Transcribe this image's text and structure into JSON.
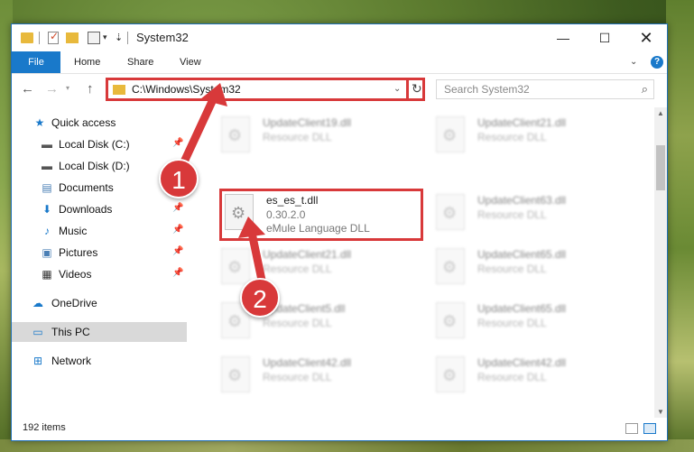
{
  "window": {
    "title": "System32",
    "controls": {
      "minimize": "—",
      "maximize": "☐",
      "close": "✕"
    }
  },
  "ribbon": {
    "tabs": [
      "File",
      "Home",
      "Share",
      "View"
    ],
    "help": "?"
  },
  "address": {
    "path": "C:\\Windows\\System32",
    "search_placeholder": "Search System32"
  },
  "nav_pane": {
    "items": [
      {
        "label": "Quick access",
        "icon": "star-icon",
        "pinned": false
      },
      {
        "label": "Local Disk (C:)",
        "icon": "drive-icon",
        "pinned": true
      },
      {
        "label": "Local Disk (D:)",
        "icon": "drive-icon",
        "pinned": false
      },
      {
        "label": "Documents",
        "icon": "documents-icon",
        "pinned": true
      },
      {
        "label": "Downloads",
        "icon": "download-icon",
        "pinned": true
      },
      {
        "label": "Music",
        "icon": "music-icon",
        "pinned": true
      },
      {
        "label": "Pictures",
        "icon": "pictures-icon",
        "pinned": true
      },
      {
        "label": "Videos",
        "icon": "videos-icon",
        "pinned": true
      },
      {
        "label": "OneDrive",
        "icon": "cloud-icon",
        "pinned": false
      },
      {
        "label": "This PC",
        "icon": "computer-icon",
        "pinned": false,
        "selected": true
      },
      {
        "label": "Network",
        "icon": "network-icon",
        "pinned": false
      }
    ]
  },
  "files": {
    "selected": {
      "name": "es_es_t.dll",
      "version": "0.30.2.0",
      "description": "eMule Language DLL"
    },
    "background": [
      {
        "name": "UpdateClient19.dll",
        "type": "Resource DLL"
      },
      {
        "name": "UpdateClient21.dll",
        "type": "Resource DLL"
      },
      {
        "name": "UpdateClient63.dll",
        "type": "Resource DLL"
      },
      {
        "name": "UpdateClient21.dll",
        "type": "Resource DLL"
      },
      {
        "name": "UpdateClient65.dll",
        "type": "Resource DLL"
      },
      {
        "name": "UpdateClient5.dll",
        "type": "Resource DLL"
      },
      {
        "name": "UpdateClient65.dll",
        "type": "Resource DLL"
      },
      {
        "name": "UpdateClient42.dll",
        "type": "Resource DLL"
      },
      {
        "name": "UpdateClient42.dll",
        "type": "Resource DLL"
      }
    ]
  },
  "status": {
    "count": "192 items"
  },
  "annotations": {
    "step1": "1",
    "step2": "2",
    "color": "#d8393a"
  }
}
